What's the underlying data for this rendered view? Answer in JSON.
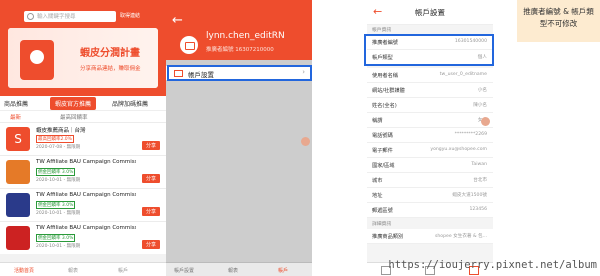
{
  "panel1": {
    "search_placeholder": "輸入關鍵字搜尋",
    "search_label": "取得連結",
    "banner": {
      "title": "蝦皮分潤計畫",
      "sub": "分享商品連結，賺取佣金"
    },
    "tabs": [
      "商品推薦",
      "蝦皮官方推薦",
      "品牌加碼推薦"
    ],
    "subtabs": [
      "最新",
      "最高回饋率"
    ],
    "items": [
      {
        "title": "蝦皮推薦商品｜台灣",
        "comm": "最高回饋率2.0%",
        "date": "2020-07-08 - 無限期",
        "share": "分享"
      },
      {
        "title": "TW Affiliate BAU Campaign Commission...",
        "comm": "佣金回饋率 3.0%",
        "date": "2020-10-01 - 無限期",
        "share": "分享"
      },
      {
        "title": "TW Affiliate BAU Campaign Commission...",
        "comm": "佣金回饋率 3.0%",
        "date": "2020-10-01 - 無限期",
        "share": "分享"
      },
      {
        "title": "TW Affiliate BAU Campaign Commission...",
        "comm": "佣金回饋率 3.0%",
        "date": "2020-10-01 - 無限期",
        "share": "分享"
      },
      {
        "title": "TW Affiliate BAU Campaign Commission...",
        "comm": "佣金回饋率 3.0%",
        "date": "2020-10-01 - 無限期",
        "share": "分享"
      }
    ],
    "nav": [
      "活動首頁",
      "報表",
      "帳戶"
    ]
  },
  "panel2": {
    "username": "lynn.chen_editRN",
    "account_id": "推廣者編號 16307210000",
    "row_label": "帳戶設置",
    "nav": [
      "帳戶設置",
      "報表",
      "帳戶"
    ]
  },
  "panel3": {
    "title": "帳戶設置",
    "sections": [
      "帳戶資訊",
      "詳細資訊"
    ],
    "rows": [
      {
        "k": "推廣者編號",
        "v": "16301540000"
      },
      {
        "k": "帳戶類型",
        "v": "個人"
      },
      {
        "k": "使用者名稱",
        "v": "tw_user_0_editname"
      },
      {
        "k": "網站/社群媒體",
        "v": "小名"
      },
      {
        "k": "姓名(全名)",
        "v": "陳小名"
      },
      {
        "k": "稱謂",
        "v": "女士"
      },
      {
        "k": "電話號碼",
        "v": "*********2269"
      },
      {
        "k": "電子郵件",
        "v": "yongyu.xu@shopee.com"
      },
      {
        "k": "國家/區域",
        "v": "Taiwan"
      },
      {
        "k": "城市",
        "v": "台北市"
      },
      {
        "k": "地址",
        "v": "蝦皮大道1500號"
      },
      {
        "k": "郵遞區號",
        "v": "123456"
      }
    ],
    "detail_row": {
      "k": "推廣商品類別",
      "v": "shopee 女生衣著 & 包..."
    }
  },
  "callout": "推廣者編號 & 帳戶類型不可修改",
  "watermark": "https://ioujerry.pixnet.net/album",
  "colors": {
    "brand": "#ee4d2d",
    "highlight": "#2266dd",
    "callout_bg": "#fdebd0"
  }
}
